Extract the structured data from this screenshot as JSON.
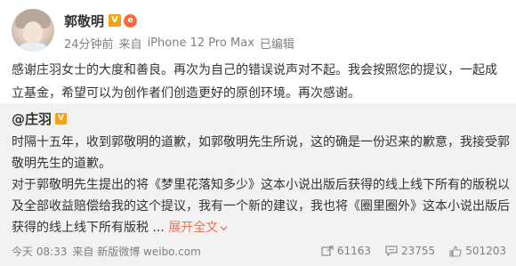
{
  "post": {
    "author": "郭敬明",
    "verified_badge": "V",
    "level_badge": "e",
    "time": "24分钟前",
    "source_prefix": "来自",
    "source": "iPhone 12 Pro Max",
    "edited": "已编辑",
    "text": "感谢庄羽女士的大度和善良。再次为自己的错误说声对不起。我会按照您的提议，一起成立基金，希望可以为创作者们创造更好的原创环境。再次感谢。"
  },
  "repost": {
    "author": "@庄羽",
    "verified_badge": "V",
    "paragraph1": "时隔十五年，收到郭敬明的道歉，如郭敬明先生所说，这的确是一份迟来的歉意，我接受郭敬明先生的道歉。",
    "paragraph2": "对于郭敬明先生提出的将《梦里花落知多少》这本小说出版后获得的线上线下所有的版税以及全部收益赔偿给我的这个提议，我有一个新的建议，我也将《圈里圈外》这本小说出版后获得的线上线下所有版税",
    "ellipsis": " ... ",
    "expand_label": "展开全文",
    "expand_icon": "chevron-down-icon",
    "footer": {
      "time": "今天 08:33",
      "source": "来自 新版微博 weibo.com",
      "reposts": "61163",
      "comments": "23755",
      "likes": "501203"
    }
  },
  "colors": {
    "accent_link": "#eb7350",
    "verified": "#f7a10c",
    "repost_bg": "#f2f2f2",
    "meta_text": "#808080"
  }
}
